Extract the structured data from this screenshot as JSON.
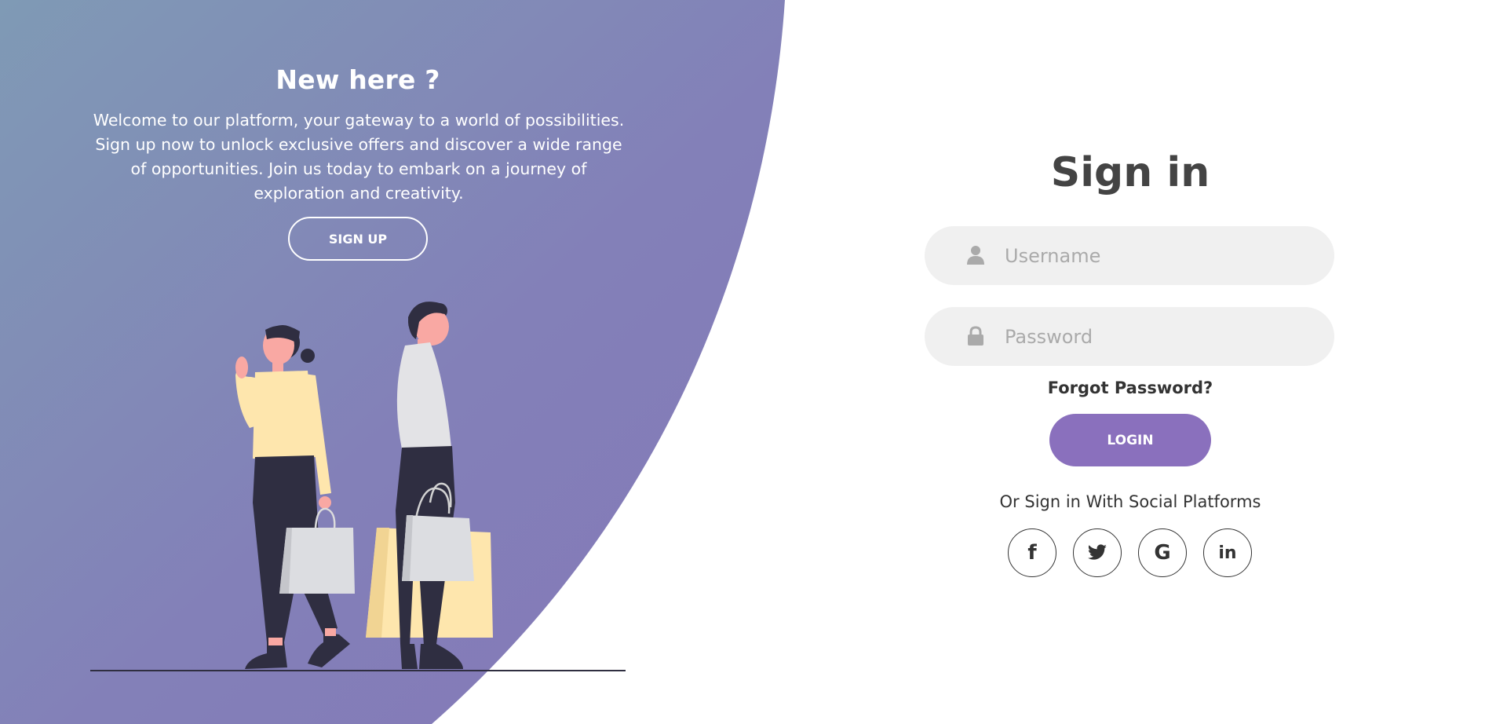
{
  "left_panel": {
    "title": "New here ?",
    "description": "Welcome to our platform, your gateway to a world of possibilities. Sign up now to unlock exclusive offers and discover a wide range of opportunities. Join us today to embark on a journey of exploration and creativity.",
    "signup_label": "SIGN UP"
  },
  "sign_in": {
    "title": "Sign in",
    "username_placeholder": "Username",
    "password_placeholder": "Password",
    "forgot_label": "Forgot Password?",
    "login_label": "LOGIN",
    "social_text": "Or Sign in With Social Platforms",
    "social": {
      "facebook": "f",
      "google": "G",
      "linkedin": "in"
    }
  },
  "colors": {
    "accent": "#8a70bd",
    "gradient_start": "#7f9ab5",
    "gradient_end": "#8478b8",
    "input_bg": "#f0f0f0",
    "text_dark": "#333333"
  },
  "icons": {
    "username": "user-icon",
    "password": "lock-icon",
    "social": [
      "facebook-icon",
      "twitter-icon",
      "google-icon",
      "linkedin-icon"
    ]
  }
}
